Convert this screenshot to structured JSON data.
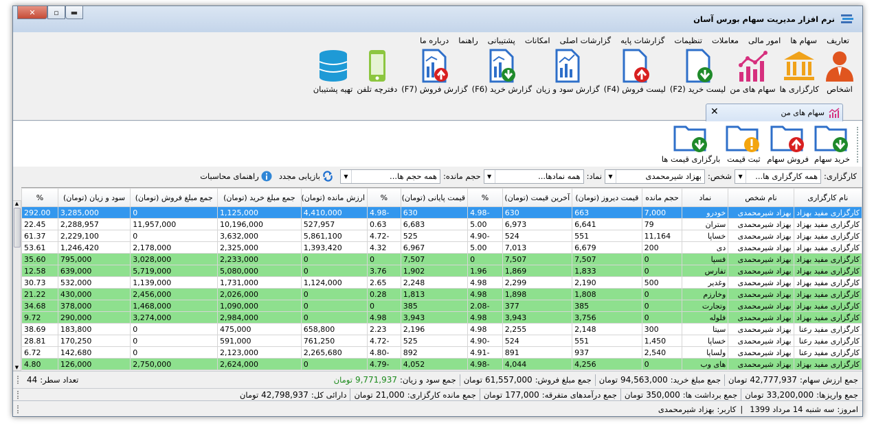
{
  "window": {
    "title": "نرم افزار مدیریت سهام بورس آسان",
    "buttons": {
      "close": "✕",
      "maximize": "▫",
      "minimize": "▬"
    }
  },
  "menu": [
    "تعاریف",
    "سهام ها",
    "امور مالی",
    "معاملات",
    "تنظیمات",
    "گزارشات پایه",
    "گزارشات اصلی",
    "امکانات",
    "پشتیبانی",
    "راهنما",
    "درباره ما"
  ],
  "ribbon": [
    {
      "label": "اشخاص",
      "icon": "person-icon"
    },
    {
      "label": "کارگزاری ها",
      "icon": "bank-icon"
    },
    {
      "label": "سهام های من",
      "icon": "chart-icon"
    },
    {
      "label": "لیست خرید (F2)",
      "icon": "doc-down-icon"
    },
    {
      "label": "لیست فروش (F4)",
      "icon": "doc-up-icon"
    },
    {
      "label": "گزارش سود و زیان",
      "icon": "report-icon"
    },
    {
      "label": "گزارش خرید (F6)",
      "icon": "report-down-icon"
    },
    {
      "label": "گزارش فروش (F7)",
      "icon": "report-up-icon"
    },
    {
      "label": "دفترچه تلفن",
      "icon": "phone-icon"
    },
    {
      "label": "تهیه پشتیبان",
      "icon": "database-icon"
    }
  ],
  "tab": {
    "label": "سهام های من",
    "close": "✕"
  },
  "subtoolbar": [
    {
      "label": "خرید سهام",
      "icon": "folder-down-icon"
    },
    {
      "label": "فروش سهام",
      "icon": "folder-up-icon"
    },
    {
      "label": "ثبت قیمت",
      "icon": "folder-warning-icon"
    },
    {
      "label": "بارگزاری قیمت ها",
      "icon": "folder-load-icon"
    }
  ],
  "filters": {
    "broker_label": "کارگزاری:",
    "broker_value": "همه کارگزاری ها...",
    "person_label": "شخص:",
    "person_value": "بهزاد شیرمحمدی",
    "symbol_label": "نماد:",
    "symbol_value": "همه نمادها...",
    "remain_label": "حجم مانده:",
    "remain_value": "همه حجم ها...",
    "refresh_label": "بازیابی مجدد",
    "help_label": "راهنمای محاسبات"
  },
  "grid": {
    "columns": [
      "نام کارگزاری",
      "نام شخص",
      "نماد",
      "حجم مانده",
      "قیمت دیروز (تومان)",
      "آخرین قیمت (تومان)",
      "%",
      "قیمت پایانی (تومان)",
      "%",
      "ارزش مانده (تومان)",
      "جمع مبلغ خرید (تومان)",
      "جمع مبلغ فروش (تومان)",
      "سود و زیان (تومان)",
      "%"
    ],
    "rows": [
      {
        "s": "sel",
        "c": [
          "کارگزاری مفید بهزاد",
          "بهزاد شیرمحمدی",
          "خودرو",
          "7,000",
          "663",
          "630",
          "-4.98",
          "630",
          "-4.98",
          "4,410,000",
          "1,125,000",
          "0",
          "3,285,000",
          "292.00"
        ]
      },
      {
        "s": "white",
        "c": [
          "کارگزاری مفید بهزاد",
          "بهزاد شیرمحمدی",
          "ستران",
          "79",
          "6,641",
          "6,973",
          "5.00",
          "6,683",
          "0.63",
          "527,957",
          "10,196,000",
          "11,957,000",
          "2,288,957",
          "22.45"
        ]
      },
      {
        "s": "white",
        "c": [
          "کارگزاری مفید بهزاد",
          "بهزاد شیرمحمدی",
          "خساپا",
          "11,164",
          "551",
          "524",
          "-4.90",
          "525",
          "-4.72",
          "5,861,100",
          "3,632,000",
          "0",
          "2,229,100",
          "61.37"
        ]
      },
      {
        "s": "white",
        "c": [
          "کارگزاری مفید بهزاد",
          "بهزاد شیرمحمدی",
          "دی",
          "200",
          "6,679",
          "7,013",
          "5.00",
          "6,967",
          "4.32",
          "1,393,420",
          "2,325,000",
          "2,178,000",
          "1,246,420",
          "53.61"
        ]
      },
      {
        "s": "green",
        "c": [
          "کارگزاری مفید بهزاد",
          "بهزاد شیرمحمدی",
          "فسپا",
          "0",
          "7,507",
          "7,507",
          "0",
          "7,507",
          "0",
          "0",
          "2,233,000",
          "3,028,000",
          "795,000",
          "35.60"
        ]
      },
      {
        "s": "green",
        "c": [
          "کارگزاری مفید بهزاد",
          "بهزاد شیرمحمدی",
          "تفارس",
          "0",
          "1,833",
          "1,869",
          "1.96",
          "1,902",
          "3.76",
          "0",
          "5,080,000",
          "5,719,000",
          "639,000",
          "12.58"
        ]
      },
      {
        "s": "white",
        "c": [
          "کارگزاری مفید بهزاد",
          "بهزاد شیرمحمدی",
          "وغدیر",
          "500",
          "2,190",
          "2,299",
          "4.98",
          "2,248",
          "2.65",
          "1,124,000",
          "1,731,000",
          "1,139,000",
          "532,000",
          "30.73"
        ]
      },
      {
        "s": "green",
        "c": [
          "کارگزاری مفید بهزاد",
          "بهزاد شیرمحمدی",
          "وخارزم",
          "0",
          "1,808",
          "1,898",
          "4.98",
          "1,813",
          "0.28",
          "0",
          "2,026,000",
          "2,456,000",
          "430,000",
          "21.22"
        ]
      },
      {
        "s": "green",
        "c": [
          "کارگزاری مفید بهزاد",
          "بهزاد شیرمحمدی",
          "وتجارت",
          "0",
          "385",
          "377",
          "-2.08",
          "385",
          "0",
          "0",
          "1,090,000",
          "1,468,000",
          "378,000",
          "34.68"
        ]
      },
      {
        "s": "green",
        "c": [
          "کارگزاری مفید بهزاد",
          "بهزاد شیرمحمدی",
          "فلوله",
          "0",
          "3,756",
          "3,943",
          "4.98",
          "3,943",
          "4.98",
          "0",
          "2,984,000",
          "3,274,000",
          "290,000",
          "9.72"
        ]
      },
      {
        "s": "white",
        "c": [
          "کارگزاری مفید رعنا",
          "بهزاد شیرمحمدی",
          "سیتا",
          "300",
          "2,148",
          "2,255",
          "4.98",
          "2,196",
          "2.23",
          "658,800",
          "475,000",
          "0",
          "183,800",
          "38.69"
        ]
      },
      {
        "s": "white",
        "c": [
          "کارگزاری مفید رعنا",
          "بهزاد شیرمحمدی",
          "خساپا",
          "1,450",
          "551",
          "524",
          "-4.90",
          "525",
          "-4.72",
          "761,250",
          "591,000",
          "0",
          "170,250",
          "28.81"
        ]
      },
      {
        "s": "white",
        "c": [
          "کارگزاری مفید رعنا",
          "بهزاد شیرمحمدی",
          "ولساپا",
          "2,540",
          "937",
          "891",
          "-4.91",
          "892",
          "-4.80",
          "2,265,680",
          "2,123,000",
          "0",
          "142,680",
          "6.72"
        ]
      },
      {
        "s": "green",
        "c": [
          "کارگزاری مفید بهزاد",
          "بهزاد شیرمحمدی",
          "های وب",
          "0",
          "4,256",
          "4,044",
          "-4.98",
          "4,052",
          "-4.79",
          "0",
          "2,624,000",
          "2,750,000",
          "126,000",
          "4.80"
        ]
      }
    ]
  },
  "summary1": {
    "value_label": "جمع ارزش سهام:",
    "value": "42,777,937",
    "unit": "تومان",
    "buy_label": "جمع مبلغ خرید:",
    "buy": "94,563,000",
    "sell_label": "جمع مبلغ فروش:",
    "sell": "61,557,000",
    "profit_label": "جمع سود و زیان:",
    "profit": "9,771,937",
    "rows_label": "تعداد سطر:",
    "rows": "44"
  },
  "summary2": {
    "deposit_label": "جمع واریزها:",
    "deposit": "33,200,000",
    "withdraw_label": "جمع برداشت ها:",
    "withdraw": "350,000",
    "misc_label": "جمع درآمدهای متفرقه:",
    "misc": "177,000",
    "broker_label": "جمع مانده کارگزاری:",
    "broker": "21,000",
    "assets_label": "دارائی کل:",
    "assets": "42,798,937",
    "unit": "تومان"
  },
  "status": {
    "today_label": "امروز:",
    "today": "سه شنبه 14 مرداد 1399",
    "sep": "|",
    "user_label": "کاربر:",
    "user": "بهزاد شیرمحمدی"
  }
}
